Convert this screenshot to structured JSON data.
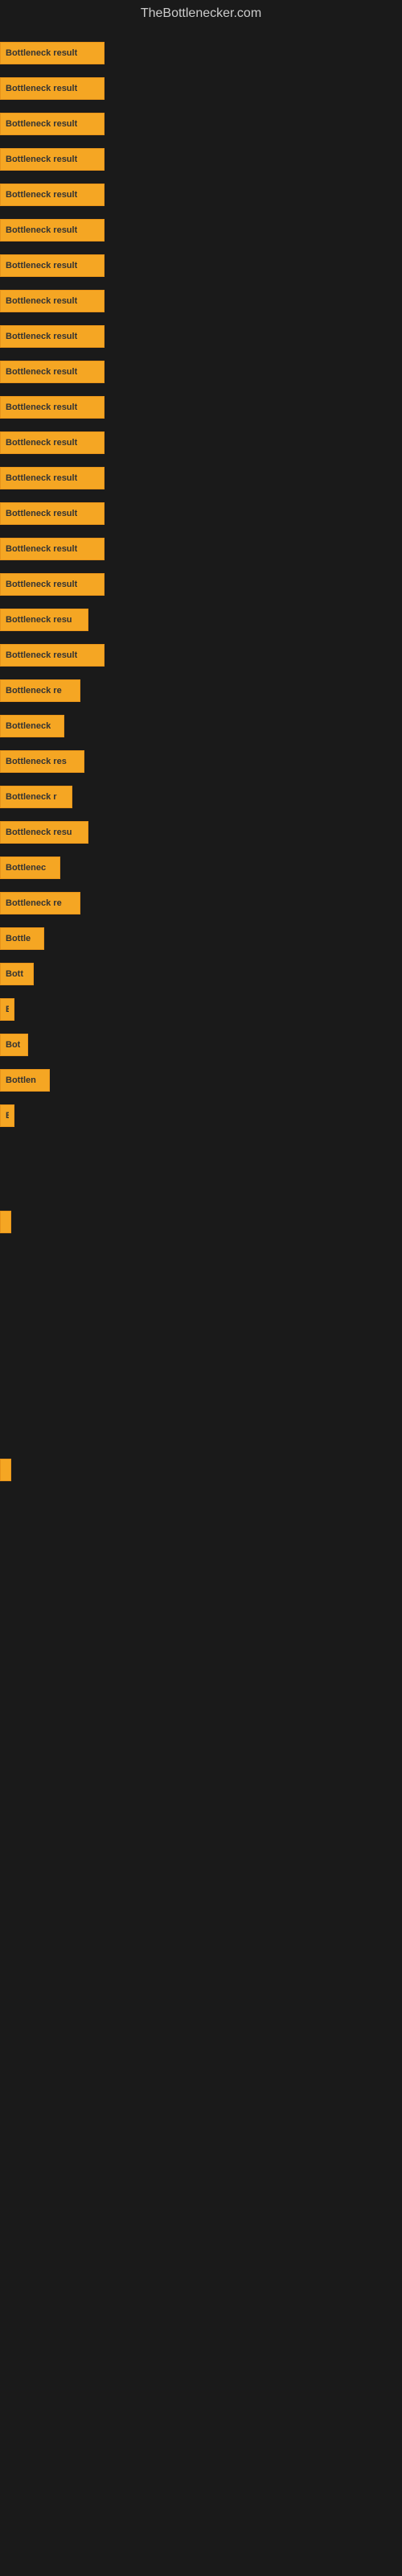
{
  "site": {
    "title": "TheBottlenecker.com"
  },
  "bars": [
    {
      "label": "Bottleneck result",
      "width": 130
    },
    {
      "label": "Bottleneck result",
      "width": 130
    },
    {
      "label": "Bottleneck result",
      "width": 130
    },
    {
      "label": "Bottleneck result",
      "width": 130
    },
    {
      "label": "Bottleneck result",
      "width": 130
    },
    {
      "label": "Bottleneck result",
      "width": 130
    },
    {
      "label": "Bottleneck result",
      "width": 130
    },
    {
      "label": "Bottleneck result",
      "width": 130
    },
    {
      "label": "Bottleneck result",
      "width": 130
    },
    {
      "label": "Bottleneck result",
      "width": 130
    },
    {
      "label": "Bottleneck result",
      "width": 130
    },
    {
      "label": "Bottleneck result",
      "width": 130
    },
    {
      "label": "Bottleneck result",
      "width": 130
    },
    {
      "label": "Bottleneck result",
      "width": 130
    },
    {
      "label": "Bottleneck result",
      "width": 130
    },
    {
      "label": "Bottleneck result",
      "width": 130
    },
    {
      "label": "Bottleneck resu",
      "width": 110
    },
    {
      "label": "Bottleneck result",
      "width": 130
    },
    {
      "label": "Bottleneck re",
      "width": 100
    },
    {
      "label": "Bottleneck",
      "width": 80
    },
    {
      "label": "Bottleneck res",
      "width": 105
    },
    {
      "label": "Bottleneck r",
      "width": 90
    },
    {
      "label": "Bottleneck resu",
      "width": 110
    },
    {
      "label": "Bottlenec",
      "width": 75
    },
    {
      "label": "Bottleneck re",
      "width": 100
    },
    {
      "label": "Bottle",
      "width": 55
    },
    {
      "label": "Bott",
      "width": 42
    },
    {
      "label": "B",
      "width": 18
    },
    {
      "label": "Bot",
      "width": 35
    },
    {
      "label": "Bottlen",
      "width": 62
    },
    {
      "label": "B",
      "width": 18
    },
    {
      "label": "",
      "width": 0
    },
    {
      "label": "",
      "width": 0
    },
    {
      "label": "|",
      "width": 10
    },
    {
      "label": "",
      "width": 0
    },
    {
      "label": "",
      "width": 0
    },
    {
      "label": "",
      "width": 0
    },
    {
      "label": "",
      "width": 0
    },
    {
      "label": "",
      "width": 0
    },
    {
      "label": "",
      "width": 0
    },
    {
      "label": "|",
      "width": 10
    }
  ]
}
